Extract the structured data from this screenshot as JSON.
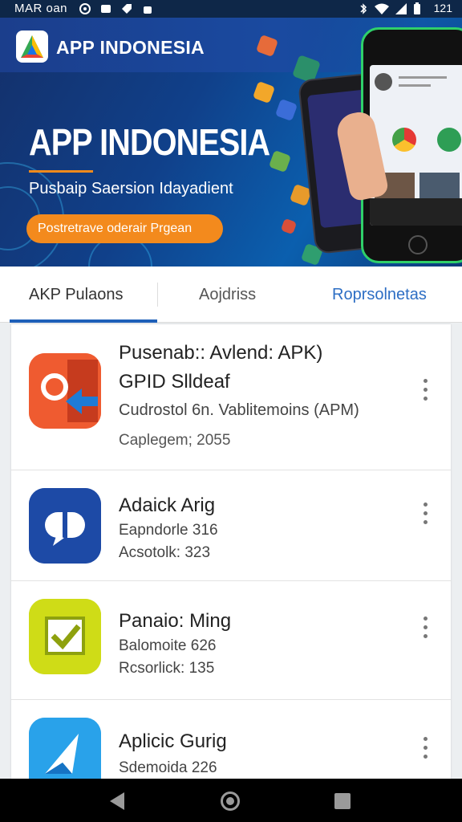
{
  "status_bar": {
    "left_text": "MAR oan",
    "time": "121"
  },
  "banner": {
    "brand": "APP INDONESIA",
    "headline": "APP INDONESIA",
    "tagline": "Pusbaip Saersion Idayadient",
    "cta_label": "Postretrave oderair Prgean"
  },
  "tabs": [
    {
      "label": "AKP Pulaons",
      "active": true
    },
    {
      "label": "Aojdriss",
      "active": false
    },
    {
      "label": "Roprsolnetas",
      "active": false
    }
  ],
  "apps": [
    {
      "title_line1": "Pusenab:: Avlend: APK)",
      "title_line2": "GPID Slldeaf",
      "subtitle": "Cudrostol 6n. Vablitemoins (APM)",
      "meta": "Caplegem; 2055",
      "icon": "office-document-icon"
    },
    {
      "title_line1": "Adaick Arig",
      "meta1": "Eapndorle 316",
      "meta2": "Acsotolk: 323",
      "icon": "speech-bubble-icon"
    },
    {
      "title_line1": "Panaio: Ming",
      "meta1": "Balomoite 626",
      "meta2": "Rcsorlick: 135",
      "icon": "checkbox-icon"
    },
    {
      "title_line1": "Aplicic Gurig",
      "meta1": "Sdemoida 226",
      "icon": "sail-arrow-icon"
    }
  ],
  "colors": {
    "accent": "#1e5fb8",
    "cta": "#f38a1d",
    "banner_dark": "#14306a"
  }
}
